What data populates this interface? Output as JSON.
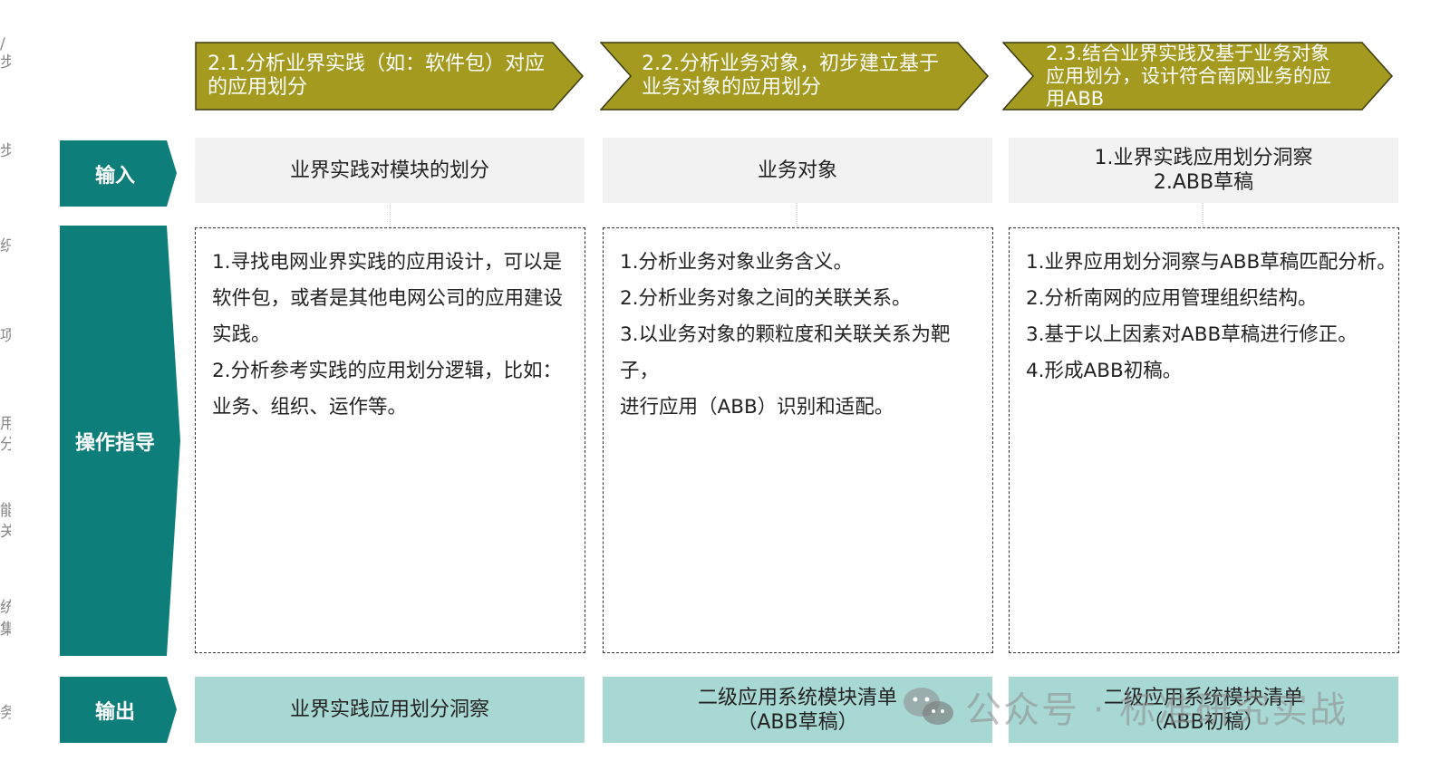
{
  "edge_glyphs": [
    "/",
    "步",
    "步",
    "织",
    "项",
    "用",
    "分",
    "能",
    "关",
    "",
    "统",
    "集",
    "务"
  ],
  "steps": [
    {
      "text": "2.1.分析业界实践（如：软件包）对应的应用划分"
    },
    {
      "text": "2.2.分析业务对象，初步建立基于业务对象的应用划分"
    },
    {
      "text": "2.3.结合业界实践及基于业务对象应用划分，设计符合南网业务的应用ABB"
    }
  ],
  "row_labels": {
    "input": "输入",
    "guide": "操作指导",
    "output": "输出"
  },
  "inputs": [
    {
      "lines": [
        "业界实践对模块的划分"
      ]
    },
    {
      "lines": [
        "业务对象"
      ]
    },
    {
      "lines": [
        "1.业界实践应用划分洞察",
        "2.ABB草稿"
      ]
    }
  ],
  "guides": [
    {
      "lines": [
        "1.寻找电网业界实践的应用设计，可以是",
        "软件包，或者是其他电网公司的应用建设",
        "实践。",
        "2.分析参考实践的应用划分逻辑，比如：",
        "业务、组织、运作等。"
      ]
    },
    {
      "lines": [
        "1.分析业务对象业务含义。",
        "2.分析业务对象之间的关联关系。",
        "3.以业务对象的颗粒度和关联关系为靶子，",
        "进行应用（ABB）识别和适配。"
      ]
    },
    {
      "lines": [
        "1.业界应用划分洞察与ABB草稿匹配分析。",
        "2.分析南网的应用管理组织结构。",
        "3.基于以上因素对ABB草稿进行修正。",
        "4.形成ABB初稿。"
      ]
    }
  ],
  "outputs": [
    {
      "lines": [
        "业界实践应用划分洞察"
      ]
    },
    {
      "lines": [
        "二级应用系统模块清单",
        "（ABB草稿）"
      ]
    },
    {
      "lines": [
        "二级应用系统模块清单",
        "（ABB初稿）"
      ]
    }
  ],
  "watermark": {
    "text": "公众号 · 标准研究实战"
  },
  "colors": {
    "step_fill": "#a39a1f",
    "label_fill": "#0e7e7a",
    "output_fill": "#a8d8d3",
    "input_fill": "#f2f2f2"
  }
}
